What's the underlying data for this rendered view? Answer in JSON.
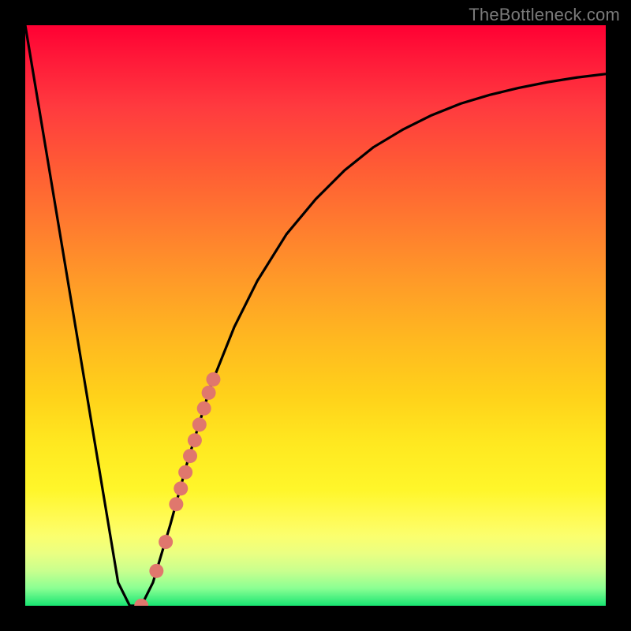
{
  "watermark": "TheBottleneck.com",
  "chart_data": {
    "type": "line",
    "title": "",
    "xlabel": "",
    "ylabel": "",
    "xlim": [
      0,
      100
    ],
    "ylim": [
      0,
      100
    ],
    "grid": false,
    "series": [
      {
        "name": "bottleneck-curve",
        "color": "#000000",
        "x": [
          0,
          2,
          4,
          6,
          8,
          10,
          12,
          14,
          16,
          18,
          20,
          22,
          25,
          28,
          32,
          36,
          40,
          45,
          50,
          55,
          60,
          65,
          70,
          75,
          80,
          85,
          90,
          95,
          100
        ],
        "y": [
          100,
          88,
          76,
          64,
          52,
          40,
          28,
          16,
          4,
          0,
          0,
          4,
          14,
          25,
          38,
          48,
          56,
          64,
          70,
          75,
          79,
          82,
          84.5,
          86.5,
          88,
          89.2,
          90.2,
          91,
          91.6
        ]
      }
    ],
    "markers": [
      {
        "name": "highlight-beads",
        "color": "#e0776d",
        "radius_px": 9,
        "points": [
          {
            "x": 20.0,
            "y": 0.0
          },
          {
            "x": 22.6,
            "y": 6.0
          },
          {
            "x": 24.2,
            "y": 11.0
          },
          {
            "x": 26.0,
            "y": 17.5
          },
          {
            "x": 26.8,
            "y": 20.2
          },
          {
            "x": 27.6,
            "y": 23.0
          },
          {
            "x": 28.4,
            "y": 25.8
          },
          {
            "x": 29.2,
            "y": 28.5
          },
          {
            "x": 30.0,
            "y": 31.2
          },
          {
            "x": 30.8,
            "y": 34.0
          },
          {
            "x": 31.6,
            "y": 36.7
          },
          {
            "x": 32.4,
            "y": 39.0
          }
        ]
      }
    ],
    "background_gradient": {
      "top": "#ff0033",
      "mid": "#ffd21a",
      "bottom": "#18e572"
    }
  }
}
